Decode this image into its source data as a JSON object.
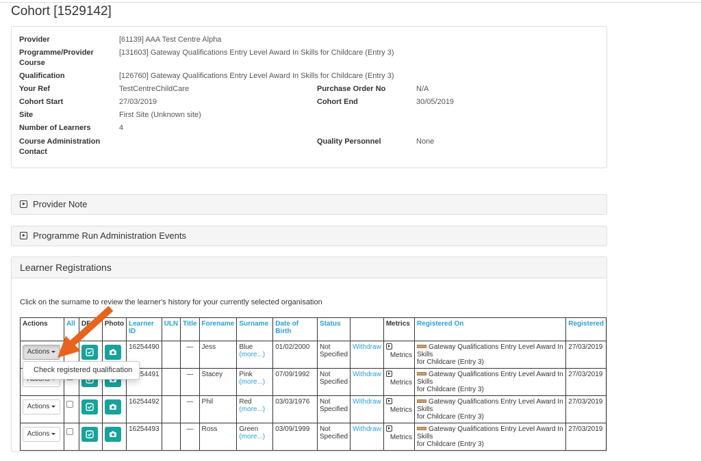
{
  "page_title": "Cohort [1529142]",
  "info": {
    "provider_label": "Provider",
    "provider_value": "[61139] AAA Test Centre Alpha",
    "programme_label_line1": "Programme/Provider",
    "programme_label_line2": "Course",
    "programme_value": "[131603] Gateway Qualifications Entry Level Award In Skills for Childcare (Entry 3)",
    "qualification_label": "Qualification",
    "qualification_value": "[126760] Gateway Qualifications Entry Level Award In Skills for Childcare (Entry 3)",
    "your_ref_label": "Your Ref",
    "your_ref_value": "TestCentreChildCare",
    "po_label": "Purchase Order No",
    "po_value": "N/A",
    "cohort_start_label": "Cohort Start",
    "cohort_start_value": "27/03/2019",
    "cohort_end_label": "Cohort End",
    "cohort_end_value": "30/05/2019",
    "site_label": "Site",
    "site_value": "First Site (Unknown site)",
    "learners_label": "Number of Learners",
    "learners_value": "4",
    "admin_contact_label_line1": "Course Administration",
    "admin_contact_label_line2": "Contact",
    "quality_label": "Quality Personnel",
    "quality_value": "None"
  },
  "panels": {
    "provider_note": "Provider Note",
    "admin_events": "Programme Run Administration Events",
    "learner_registrations": "Learner Registrations"
  },
  "help_text": "Click on the surname to review the learner's history for your currently selected organisation",
  "table": {
    "headers": {
      "actions": "Actions",
      "all": "All",
      "de": "DE",
      "photo": "Photo",
      "learner_id": "Learner ID",
      "uln": "ULN",
      "title": "Title",
      "forename": "Forename",
      "surname": "Surname",
      "dob": "Date of Birth",
      "status": "Status",
      "metrics": "Metrics",
      "registered_on": "Registered On",
      "registered": "Registered"
    },
    "actions_label": "Actions",
    "more_label": "(more...)",
    "withdraw_label": "Withdraw",
    "metrics_label": "Metrics",
    "dash": "—",
    "rows": [
      {
        "learner_id": "16254490",
        "forename": "Jess",
        "surname": "Blue",
        "dob": "01/02/2000",
        "status_line1": "Not",
        "status_line2": "Specified",
        "reg_on_line1": "Gateway Qualifications Entry Level Award In Skills",
        "reg_on_line2": "for Childcare (Entry 3)",
        "registered": "27/03/2019"
      },
      {
        "learner_id": "16254491",
        "forename": "Stacey",
        "surname": "Pink",
        "dob": "07/09/1992",
        "status_line1": "Not",
        "status_line2": "Specified",
        "reg_on_line1": "Gateway Qualifications Entry Level Award In Skills",
        "reg_on_line2": "for Childcare (Entry 3)",
        "registered": "27/03/2019"
      },
      {
        "learner_id": "16254492",
        "forename": "Phil",
        "surname": "Red",
        "dob": "03/03/1976",
        "status_line1": "Not",
        "status_line2": "Specified",
        "reg_on_line1": "Gateway Qualifications Entry Level Award In Skills",
        "reg_on_line2": "for Childcare (Entry 3)",
        "registered": "27/03/2019"
      },
      {
        "learner_id": "16254493",
        "forename": "Ross",
        "surname": "Green",
        "dob": "03/09/1999",
        "status_line1": "Not",
        "status_line2": "Specified",
        "reg_on_line1": "Gateway Qualifications Entry Level Award In Skills",
        "reg_on_line2": "for Childcare (Entry 3)",
        "registered": "27/03/2019"
      }
    ]
  },
  "dropdown": {
    "item": "Check registered qualification"
  },
  "colors": {
    "link": "#2a9fd6",
    "teal_button": "#17a39b",
    "arrow": "#e8641e"
  }
}
